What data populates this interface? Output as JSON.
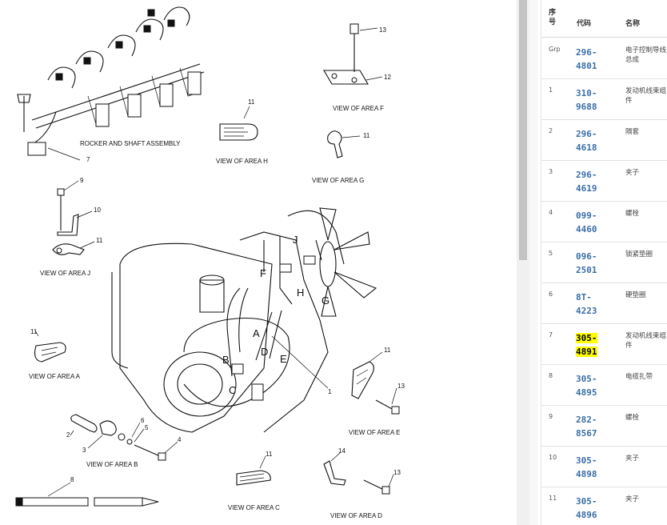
{
  "diagram": {
    "labels": {
      "rocker": "ROCKER AND SHAFT ASSEMBLY",
      "area_h": "VIEW OF AREA H",
      "area_f": "VIEW OF AREA F",
      "area_g": "VIEW OF AREA G",
      "area_j": "VIEW OF AREA J",
      "area_a": "VIEW OF AREA A",
      "area_b": "VIEW OF AREA B",
      "area_c": "VIEW OF AREA C",
      "area_d": "VIEW OF AREA D",
      "area_e": "VIEW OF AREA E"
    },
    "letters": {
      "j": "J",
      "f": "F",
      "h": "H",
      "g": "G",
      "a": "A",
      "b": "B",
      "c": "C",
      "d": "D",
      "e": "E"
    },
    "numbers": {
      "n1": "1",
      "n2": "2",
      "n3": "3",
      "n4": "4",
      "n5": "5",
      "n6": "6",
      "n7": "7",
      "n8": "8",
      "n9": "9",
      "n10": "10",
      "n11a": "11",
      "n11b": "11",
      "n11c": "11",
      "n11d": "11",
      "n11e": "11",
      "n11f": "11",
      "n12": "12",
      "n13a": "13",
      "n13b": "13",
      "n13c": "13",
      "n14": "14"
    }
  },
  "table": {
    "headers": {
      "seq": "序\n号",
      "code": "代码",
      "name": "名称"
    },
    "rows": [
      {
        "seq": "Grp",
        "code": "296-4801",
        "name": "电子控制导线总成"
      },
      {
        "seq": "1",
        "code": "310-9688",
        "name": "发动机线束组件"
      },
      {
        "seq": "2",
        "code": "296-4618",
        "name": "隔套"
      },
      {
        "seq": "3",
        "code": "296-4619",
        "name": "夹子"
      },
      {
        "seq": "4",
        "code": "099-4460",
        "name": "螺栓"
      },
      {
        "seq": "5",
        "code": "096-2501",
        "name": "锁紧垫圈"
      },
      {
        "seq": "6",
        "code": "8T-4223",
        "name": "硬垫圈"
      },
      {
        "seq": "7",
        "code": "305-4891",
        "name": "发动机线束组件",
        "highlight": true
      },
      {
        "seq": "8",
        "code": "305-4895",
        "name": "电缆扎带"
      },
      {
        "seq": "9",
        "code": "282-8567",
        "name": "螺栓"
      },
      {
        "seq": "10",
        "code": "305-4898",
        "name": "夹子"
      },
      {
        "seq": "11",
        "code": "305-4896",
        "name": "夹子"
      }
    ]
  },
  "colors": {
    "link": "#3a6ea5",
    "highlight": "#ffff00"
  }
}
